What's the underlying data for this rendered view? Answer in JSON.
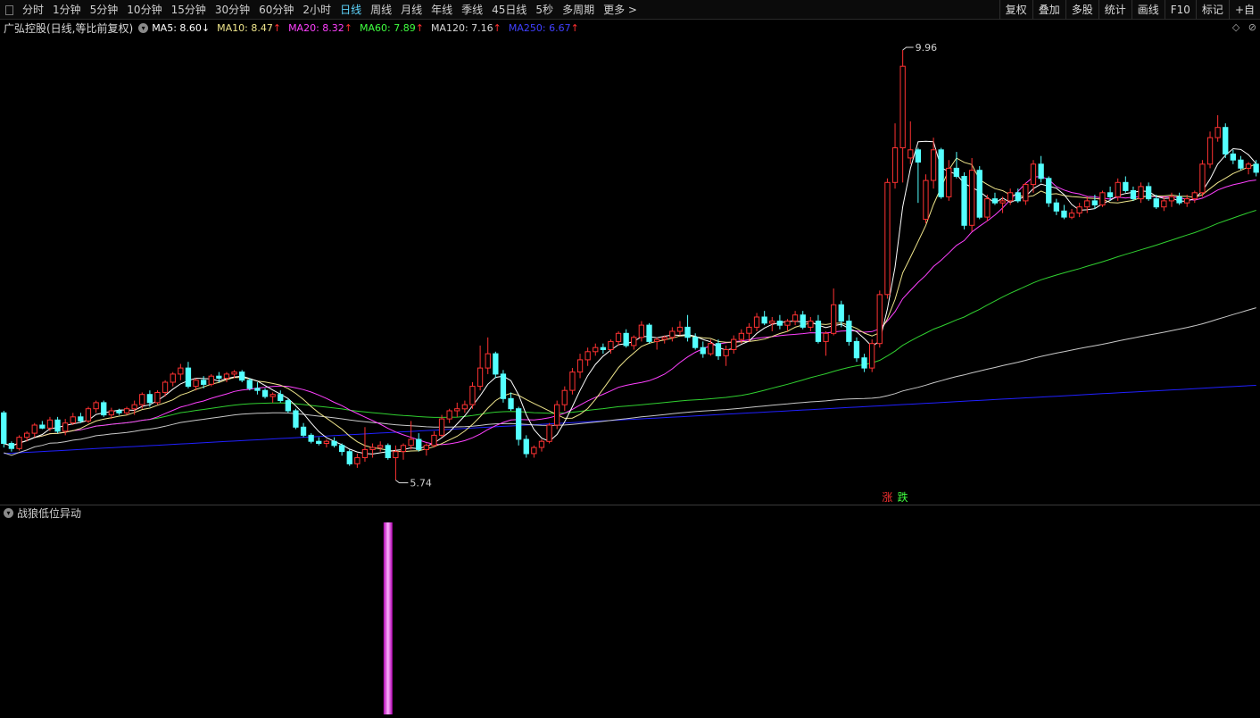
{
  "toolbar": {
    "period_tabs": [
      {
        "label": "分时",
        "active": false
      },
      {
        "label": "1分钟",
        "active": false
      },
      {
        "label": "5分钟",
        "active": false
      },
      {
        "label": "10分钟",
        "active": false
      },
      {
        "label": "15分钟",
        "active": false
      },
      {
        "label": "30分钟",
        "active": false
      },
      {
        "label": "60分钟",
        "active": false
      },
      {
        "label": "2小时",
        "active": false
      },
      {
        "label": "日线",
        "active": true
      },
      {
        "label": "周线",
        "active": false
      },
      {
        "label": "月线",
        "active": false
      },
      {
        "label": "年线",
        "active": false
      },
      {
        "label": "季线",
        "active": false
      },
      {
        "label": "45日线",
        "active": false
      },
      {
        "label": "5秒",
        "active": false
      },
      {
        "label": "多周期",
        "active": false
      },
      {
        "label": "更多 >",
        "active": false
      }
    ],
    "right_tools": [
      "复权",
      "叠加",
      "多股",
      "统计",
      "画线",
      "F10",
      "标记",
      "+自"
    ]
  },
  "header": {
    "stock_title": "广弘控股(日线,等比前复权)",
    "ma_items": [
      {
        "label": "MA5: 8.60",
        "arrow": "↓",
        "color": "#ffffff"
      },
      {
        "label": "MA10: 8.47",
        "arrow": "↑",
        "color": "#f0e68c"
      },
      {
        "label": "MA20: 8.32",
        "arrow": "↑",
        "color": "#ff40ff"
      },
      {
        "label": "MA60: 7.89",
        "arrow": "↑",
        "color": "#40ff40"
      },
      {
        "label": "MA120: 7.16",
        "arrow": "↑",
        "color": "#d8d8d8"
      },
      {
        "label": "MA250: 6.67",
        "arrow": "↑",
        "color": "#4040ff"
      }
    ],
    "icons": [
      "◇",
      "⊘"
    ]
  },
  "markers": {
    "high_label": "9.96",
    "low_label": "5.74",
    "rise_label": "涨",
    "fall_label": "跌"
  },
  "indicator": {
    "title": "战狼低位异动"
  },
  "colors": {
    "up": "#ff3232",
    "down": "#54ffff",
    "ma5": "#ffffff",
    "ma10": "#f0e68c",
    "ma20": "#ff40ff",
    "ma60": "#30d030",
    "ma120": "#c8c8c8",
    "ma250": "#2020ff",
    "signal": "#ff5cff"
  },
  "chart_data": [
    {
      "type": "candlestick",
      "y_range": [
        5.5,
        10.1
      ],
      "high": {
        "value": 9.96
      },
      "low": {
        "value": 5.74
      },
      "candles_ohlc": [
        [
          6.4,
          6.42,
          6.06,
          6.1
        ],
        [
          6.1,
          6.12,
          6.02,
          6.05
        ],
        [
          6.05,
          6.18,
          6.03,
          6.16
        ],
        [
          6.16,
          6.22,
          6.12,
          6.2
        ],
        [
          6.2,
          6.3,
          6.16,
          6.28
        ],
        [
          6.28,
          6.32,
          6.24,
          6.25
        ],
        [
          6.25,
          6.36,
          6.22,
          6.33
        ],
        [
          6.33,
          6.36,
          6.2,
          6.22
        ],
        [
          6.22,
          6.34,
          6.18,
          6.3
        ],
        [
          6.3,
          6.4,
          6.28,
          6.36
        ],
        [
          6.36,
          6.4,
          6.3,
          6.32
        ],
        [
          6.32,
          6.46,
          6.3,
          6.44
        ],
        [
          6.44,
          6.52,
          6.4,
          6.5
        ],
        [
          6.5,
          6.52,
          6.36,
          6.38
        ],
        [
          6.38,
          6.45,
          6.34,
          6.42
        ],
        [
          6.42,
          6.44,
          6.38,
          6.4
        ],
        [
          6.4,
          6.46,
          6.38,
          6.44
        ],
        [
          6.44,
          6.52,
          6.38,
          6.48
        ],
        [
          6.48,
          6.6,
          6.44,
          6.58
        ],
        [
          6.58,
          6.62,
          6.46,
          6.5
        ],
        [
          6.5,
          6.62,
          6.48,
          6.6
        ],
        [
          6.6,
          6.72,
          6.56,
          6.7
        ],
        [
          6.7,
          6.8,
          6.66,
          6.78
        ],
        [
          6.78,
          6.88,
          6.72,
          6.84
        ],
        [
          6.84,
          6.9,
          6.64,
          6.66
        ],
        [
          6.66,
          6.74,
          6.62,
          6.72
        ],
        [
          6.72,
          6.76,
          6.64,
          6.68
        ],
        [
          6.68,
          6.78,
          6.66,
          6.76
        ],
        [
          6.76,
          6.8,
          6.7,
          6.74
        ],
        [
          6.74,
          6.8,
          6.7,
          6.78
        ],
        [
          6.78,
          6.82,
          6.74,
          6.8
        ],
        [
          6.8,
          6.82,
          6.7,
          6.72
        ],
        [
          6.72,
          6.74,
          6.62,
          6.64
        ],
        [
          6.64,
          6.7,
          6.58,
          6.62
        ],
        [
          6.62,
          6.64,
          6.54,
          6.56
        ],
        [
          6.56,
          6.6,
          6.5,
          6.58
        ],
        [
          6.58,
          6.62,
          6.5,
          6.52
        ],
        [
          6.52,
          6.54,
          6.4,
          6.42
        ],
        [
          6.42,
          6.44,
          6.24,
          6.26
        ],
        [
          6.26,
          6.3,
          6.16,
          6.18
        ],
        [
          6.18,
          6.2,
          6.1,
          6.12
        ],
        [
          6.12,
          6.16,
          6.08,
          6.1
        ],
        [
          6.1,
          6.14,
          6.06,
          6.12
        ],
        [
          6.12,
          6.16,
          6.06,
          6.08
        ],
        [
          6.08,
          6.1,
          5.98,
          6.02
        ],
        [
          6.02,
          6.04,
          5.88,
          5.9
        ],
        [
          5.9,
          6.0,
          5.86,
          5.96
        ],
        [
          5.96,
          6.26,
          5.92,
          6.04
        ],
        [
          6.04,
          6.1,
          5.96,
          6.06
        ],
        [
          6.06,
          6.12,
          6.02,
          6.08
        ],
        [
          6.08,
          6.1,
          5.94,
          5.96
        ],
        [
          5.96,
          6.08,
          5.74,
          6.02
        ],
        [
          6.02,
          6.1,
          5.94,
          6.08
        ],
        [
          6.08,
          6.32,
          6.04,
          6.14
        ],
        [
          6.14,
          6.2,
          6.02,
          6.04
        ],
        [
          6.04,
          6.1,
          5.98,
          6.08
        ],
        [
          6.08,
          6.22,
          6.06,
          6.18
        ],
        [
          6.18,
          6.38,
          6.16,
          6.34
        ],
        [
          6.34,
          6.44,
          6.3,
          6.42
        ],
        [
          6.42,
          6.5,
          6.36,
          6.44
        ],
        [
          6.44,
          6.52,
          6.4,
          6.48
        ],
        [
          6.48,
          6.7,
          6.44,
          6.66
        ],
        [
          6.66,
          7.06,
          6.62,
          6.84
        ],
        [
          6.84,
          7.14,
          6.78,
          6.98
        ],
        [
          6.98,
          7.0,
          6.74,
          6.78
        ],
        [
          6.78,
          6.82,
          6.5,
          6.54
        ],
        [
          6.54,
          6.6,
          6.42,
          6.44
        ],
        [
          6.44,
          6.46,
          6.08,
          6.14
        ],
        [
          6.14,
          6.18,
          5.96,
          6.0
        ],
        [
          6.0,
          6.08,
          5.96,
          6.06
        ],
        [
          6.06,
          6.14,
          6.02,
          6.12
        ],
        [
          6.12,
          6.3,
          6.1,
          6.28
        ],
        [
          6.28,
          6.52,
          6.24,
          6.48
        ],
        [
          6.48,
          6.66,
          6.42,
          6.62
        ],
        [
          6.62,
          6.84,
          6.58,
          6.8
        ],
        [
          6.8,
          6.98,
          6.74,
          6.92
        ],
        [
          6.92,
          7.04,
          6.86,
          7.0
        ],
        [
          7.0,
          7.08,
          6.96,
          7.04
        ],
        [
          7.04,
          7.08,
          6.98,
          7.02
        ],
        [
          7.02,
          7.12,
          6.98,
          7.1
        ],
        [
          7.1,
          7.2,
          7.06,
          7.18
        ],
        [
          7.18,
          7.22,
          7.04,
          7.06
        ],
        [
          7.06,
          7.16,
          7.02,
          7.14
        ],
        [
          7.14,
          7.3,
          7.1,
          7.26
        ],
        [
          7.26,
          7.28,
          7.08,
          7.1
        ],
        [
          7.1,
          7.14,
          7.02,
          7.12
        ],
        [
          7.12,
          7.16,
          7.08,
          7.14
        ],
        [
          7.14,
          7.24,
          7.1,
          7.2
        ],
        [
          7.2,
          7.3,
          7.16,
          7.24
        ],
        [
          7.24,
          7.36,
          7.1,
          7.14
        ],
        [
          7.14,
          7.18,
          7.02,
          7.04
        ],
        [
          7.04,
          7.1,
          6.94,
          6.98
        ],
        [
          6.98,
          7.12,
          6.96,
          7.08
        ],
        [
          7.08,
          7.12,
          6.92,
          6.96
        ],
        [
          6.96,
          7.06,
          6.86,
          7.02
        ],
        [
          7.02,
          7.16,
          6.98,
          7.12
        ],
        [
          7.12,
          7.22,
          7.08,
          7.18
        ],
        [
          7.18,
          7.28,
          7.1,
          7.24
        ],
        [
          7.24,
          7.38,
          7.2,
          7.34
        ],
        [
          7.34,
          7.4,
          7.26,
          7.28
        ],
        [
          7.28,
          7.34,
          7.2,
          7.3
        ],
        [
          7.3,
          7.36,
          7.22,
          7.26
        ],
        [
          7.26,
          7.32,
          7.2,
          7.3
        ],
        [
          7.3,
          7.4,
          7.26,
          7.36
        ],
        [
          7.36,
          7.4,
          7.22,
          7.24
        ],
        [
          7.24,
          7.34,
          7.2,
          7.3
        ],
        [
          7.3,
          7.36,
          7.08,
          7.1
        ],
        [
          7.1,
          7.2,
          6.96,
          7.18
        ],
        [
          7.18,
          7.62,
          7.16,
          7.46
        ],
        [
          7.46,
          7.5,
          7.24,
          7.3
        ],
        [
          7.3,
          7.36,
          7.06,
          7.1
        ],
        [
          7.1,
          7.14,
          6.9,
          6.94
        ],
        [
          6.94,
          6.98,
          6.8,
          6.84
        ],
        [
          6.84,
          7.12,
          6.8,
          7.08
        ],
        [
          7.08,
          7.6,
          7.04,
          7.56
        ],
        [
          7.56,
          8.7,
          7.52,
          8.66
        ],
        [
          8.66,
          9.24,
          8.6,
          9.0
        ],
        [
          9.0,
          9.96,
          8.66,
          9.8
        ],
        [
          8.9,
          9.26,
          8.84,
          8.98
        ],
        [
          8.98,
          9.0,
          8.46,
          8.86
        ],
        [
          8.3,
          8.74,
          8.26,
          8.68
        ],
        [
          8.68,
          9.1,
          8.6,
          8.98
        ],
        [
          8.98,
          9.0,
          8.5,
          8.52
        ],
        [
          8.52,
          8.88,
          8.48,
          8.8
        ],
        [
          8.8,
          8.96,
          8.7,
          8.72
        ],
        [
          8.72,
          8.76,
          8.2,
          8.24
        ],
        [
          8.24,
          8.9,
          8.18,
          8.78
        ],
        [
          8.78,
          8.82,
          8.3,
          8.32
        ],
        [
          8.32,
          8.54,
          8.28,
          8.5
        ],
        [
          8.5,
          8.56,
          8.44,
          8.46
        ],
        [
          8.46,
          8.52,
          8.36,
          8.48
        ],
        [
          8.48,
          8.6,
          8.44,
          8.56
        ],
        [
          8.56,
          8.6,
          8.46,
          8.48
        ],
        [
          8.48,
          8.66,
          8.44,
          8.64
        ],
        [
          8.64,
          8.88,
          8.56,
          8.84
        ],
        [
          8.84,
          8.92,
          8.66,
          8.7
        ],
        [
          8.7,
          8.72,
          8.42,
          8.46
        ],
        [
          8.46,
          8.5,
          8.34,
          8.38
        ],
        [
          8.38,
          8.44,
          8.3,
          8.32
        ],
        [
          8.32,
          8.4,
          8.3,
          8.36
        ],
        [
          8.36,
          8.46,
          8.32,
          8.42
        ],
        [
          8.42,
          8.52,
          8.36,
          8.48
        ],
        [
          8.48,
          8.54,
          8.4,
          8.44
        ],
        [
          8.44,
          8.58,
          8.42,
          8.56
        ],
        [
          8.56,
          8.62,
          8.48,
          8.52
        ],
        [
          8.52,
          8.7,
          8.48,
          8.66
        ],
        [
          8.66,
          8.72,
          8.56,
          8.58
        ],
        [
          8.58,
          8.62,
          8.48,
          8.5
        ],
        [
          8.5,
          8.66,
          8.46,
          8.62
        ],
        [
          8.62,
          8.66,
          8.48,
          8.5
        ],
        [
          8.5,
          8.54,
          8.4,
          8.42
        ],
        [
          8.42,
          8.52,
          8.38,
          8.48
        ],
        [
          8.48,
          8.56,
          8.42,
          8.52
        ],
        [
          8.52,
          8.56,
          8.44,
          8.46
        ],
        [
          8.46,
          8.54,
          8.42,
          8.5
        ],
        [
          8.5,
          8.58,
          8.46,
          8.56
        ],
        [
          8.56,
          8.88,
          8.52,
          8.84
        ],
        [
          8.84,
          9.16,
          8.8,
          9.1
        ],
        [
          9.1,
          9.32,
          9.06,
          9.2
        ],
        [
          9.2,
          9.24,
          8.9,
          8.94
        ],
        [
          8.94,
          8.98,
          8.84,
          8.88
        ],
        [
          8.88,
          8.92,
          8.78,
          8.8
        ],
        [
          8.8,
          8.86,
          8.74,
          8.84
        ],
        [
          8.84,
          8.88,
          8.72,
          8.76
        ]
      ],
      "ma_lines": {
        "ma5": "close",
        "ma10": "close",
        "ma20": "close",
        "ma60": "close",
        "ma120": "close",
        "ma250": [
          6.0,
          6.67
        ]
      }
    },
    {
      "type": "bar",
      "title": "战狼低位异动",
      "signal_candle_index": 50,
      "signal_value": 1
    }
  ]
}
